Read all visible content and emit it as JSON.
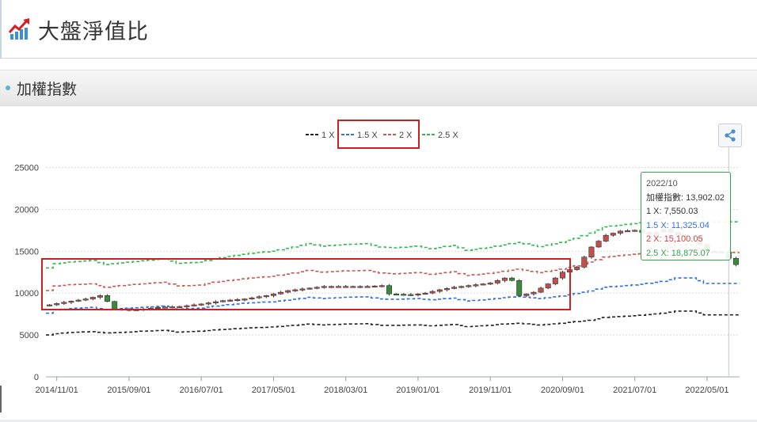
{
  "header": {
    "title": "大盤淨值比",
    "logo_icon": "rising-bar-chart-icon"
  },
  "section": {
    "label": "加權指數"
  },
  "export": {
    "icon": "share-icon"
  },
  "tooltip": {
    "date": "2022/10",
    "main": "加權指數: 13,902.02",
    "s1": "1 X: 7,550.03",
    "s2": "1.5 X: 11,325.04",
    "s3": "2 X: 15,100.05",
    "s4": "2.5 X: 18,875.07"
  },
  "colors": {
    "s1": "#222222",
    "s2": "#2f6fe0",
    "s3": "#c85a52",
    "s4": "#2eb84e",
    "up": "#c0504d",
    "down": "#3a8a3a",
    "highlight": "#d01f1f"
  },
  "chart_data": {
    "type": "line",
    "title": "",
    "xlabel": "",
    "ylabel": "",
    "ylim": [
      0,
      27500
    ],
    "yticks": [
      0,
      5000,
      10000,
      15000,
      20000,
      25000
    ],
    "xtick_labels": [
      "2014/11/01",
      "2015/09/01",
      "2016/07/01",
      "2017/05/01",
      "2018/03/01",
      "2019/01/01",
      "2019/11/01",
      "2020/09/01",
      "2021/07/01",
      "2022/05/01"
    ],
    "xtick_index": [
      1,
      11,
      21,
      31,
      41,
      51,
      61,
      71,
      81,
      91
    ],
    "start_month": "2014/10",
    "legend_position": "top",
    "series": [
      {
        "name": "1 X",
        "key": "s1",
        "knots": [
          [
            0,
            5000
          ],
          [
            1,
            5150
          ],
          [
            3,
            5300
          ],
          [
            6,
            5400
          ],
          [
            8,
            5250
          ],
          [
            10,
            5300
          ],
          [
            13,
            5450
          ],
          [
            16,
            5550
          ],
          [
            18,
            5350
          ],
          [
            21,
            5450
          ],
          [
            23,
            5600
          ],
          [
            26,
            5750
          ],
          [
            28,
            5850
          ],
          [
            31,
            5950
          ],
          [
            34,
            6150
          ],
          [
            36,
            6300
          ],
          [
            38,
            6200
          ],
          [
            41,
            6300
          ],
          [
            44,
            6350
          ],
          [
            46,
            6150
          ],
          [
            48,
            6150
          ],
          [
            51,
            6200
          ],
          [
            53,
            6100
          ],
          [
            56,
            6250
          ],
          [
            58,
            6000
          ],
          [
            61,
            6150
          ],
          [
            63,
            6300
          ],
          [
            65,
            6400
          ],
          [
            68,
            6200
          ],
          [
            71,
            6400
          ],
          [
            73,
            6600
          ],
          [
            75,
            6750
          ],
          [
            77,
            7100
          ],
          [
            80,
            7250
          ],
          [
            82,
            7350
          ],
          [
            85,
            7600
          ],
          [
            87,
            7850
          ],
          [
            89,
            7850
          ],
          [
            91,
            7400
          ],
          [
            95,
            7400
          ]
        ]
      },
      {
        "name": "1.5 X",
        "key": "s2",
        "knots": [
          [
            0,
            7600
          ],
          [
            1,
            8000
          ],
          [
            3,
            8150
          ],
          [
            6,
            8300
          ],
          [
            8,
            8000
          ],
          [
            10,
            8150
          ],
          [
            13,
            8300
          ],
          [
            16,
            8450
          ],
          [
            18,
            8100
          ],
          [
            21,
            8200
          ],
          [
            23,
            8450
          ],
          [
            26,
            8700
          ],
          [
            28,
            8850
          ],
          [
            31,
            8950
          ],
          [
            34,
            9250
          ],
          [
            36,
            9500
          ],
          [
            38,
            9350
          ],
          [
            41,
            9500
          ],
          [
            44,
            9550
          ],
          [
            46,
            9300
          ],
          [
            48,
            9250
          ],
          [
            51,
            9350
          ],
          [
            53,
            9200
          ],
          [
            56,
            9400
          ],
          [
            58,
            9050
          ],
          [
            61,
            9250
          ],
          [
            63,
            9450
          ],
          [
            65,
            9600
          ],
          [
            68,
            9350
          ],
          [
            71,
            9650
          ],
          [
            73,
            9950
          ],
          [
            75,
            10250
          ],
          [
            77,
            10700
          ],
          [
            80,
            10900
          ],
          [
            82,
            11050
          ],
          [
            85,
            11400
          ],
          [
            87,
            11800
          ],
          [
            89,
            11800
          ],
          [
            91,
            11150
          ],
          [
            95,
            11150
          ]
        ]
      },
      {
        "name": "2 X",
        "key": "s3",
        "knots": [
          [
            0,
            10300
          ],
          [
            1,
            10850
          ],
          [
            3,
            11000
          ],
          [
            6,
            11100
          ],
          [
            8,
            10700
          ],
          [
            10,
            10900
          ],
          [
            13,
            11100
          ],
          [
            16,
            11300
          ],
          [
            18,
            10850
          ],
          [
            21,
            10950
          ],
          [
            23,
            11300
          ],
          [
            26,
            11600
          ],
          [
            28,
            11800
          ],
          [
            31,
            12000
          ],
          [
            34,
            12400
          ],
          [
            36,
            12700
          ],
          [
            38,
            12500
          ],
          [
            41,
            12650
          ],
          [
            44,
            12700
          ],
          [
            46,
            12400
          ],
          [
            48,
            12300
          ],
          [
            51,
            12450
          ],
          [
            53,
            12250
          ],
          [
            56,
            12550
          ],
          [
            58,
            12100
          ],
          [
            61,
            12350
          ],
          [
            63,
            12600
          ],
          [
            65,
            12850
          ],
          [
            68,
            12450
          ],
          [
            71,
            12850
          ],
          [
            73,
            13250
          ],
          [
            75,
            13700
          ],
          [
            77,
            14300
          ],
          [
            80,
            14550
          ],
          [
            82,
            14700
          ],
          [
            85,
            15200
          ],
          [
            87,
            15750
          ],
          [
            89,
            15750
          ],
          [
            91,
            14850
          ],
          [
            95,
            14850
          ]
        ]
      },
      {
        "name": "2.5 X",
        "key": "s4",
        "knots": [
          [
            0,
            13000
          ],
          [
            1,
            13500
          ],
          [
            3,
            13700
          ],
          [
            6,
            13900
          ],
          [
            8,
            13400
          ],
          [
            10,
            13600
          ],
          [
            13,
            13850
          ],
          [
            16,
            14100
          ],
          [
            18,
            13550
          ],
          [
            21,
            13700
          ],
          [
            23,
            14100
          ],
          [
            26,
            14500
          ],
          [
            28,
            14750
          ],
          [
            31,
            15000
          ],
          [
            34,
            15500
          ],
          [
            36,
            15900
          ],
          [
            38,
            15600
          ],
          [
            41,
            15800
          ],
          [
            44,
            15900
          ],
          [
            46,
            15500
          ],
          [
            48,
            15400
          ],
          [
            51,
            15600
          ],
          [
            53,
            15300
          ],
          [
            56,
            15700
          ],
          [
            58,
            15100
          ],
          [
            61,
            15450
          ],
          [
            63,
            15750
          ],
          [
            65,
            16050
          ],
          [
            68,
            15550
          ],
          [
            71,
            16050
          ],
          [
            73,
            16550
          ],
          [
            75,
            17150
          ],
          [
            77,
            17900
          ],
          [
            80,
            18200
          ],
          [
            82,
            18400
          ],
          [
            85,
            19000
          ],
          [
            87,
            19700
          ],
          [
            89,
            19700
          ],
          [
            91,
            18500
          ],
          [
            95,
            18500
          ]
        ]
      },
      {
        "name": "加權指數",
        "key": "index",
        "type": "candlestick",
        "close_knots": [
          [
            0,
            8600
          ],
          [
            2,
            8900
          ],
          [
            5,
            9300
          ],
          [
            7,
            9700
          ],
          [
            8,
            9000
          ],
          [
            9,
            8100
          ],
          [
            12,
            8000
          ],
          [
            15,
            8300
          ],
          [
            18,
            8400
          ],
          [
            21,
            8700
          ],
          [
            24,
            9100
          ],
          [
            27,
            9300
          ],
          [
            30,
            9700
          ],
          [
            33,
            10300
          ],
          [
            36,
            10600
          ],
          [
            38,
            10800
          ],
          [
            41,
            10800
          ],
          [
            44,
            10800
          ],
          [
            46,
            10900
          ],
          [
            47,
            9900
          ],
          [
            50,
            9800
          ],
          [
            52,
            10000
          ],
          [
            54,
            10400
          ],
          [
            56,
            10700
          ],
          [
            58,
            10900
          ],
          [
            61,
            11200
          ],
          [
            63,
            11800
          ],
          [
            64,
            11500
          ],
          [
            65,
            9700
          ],
          [
            67,
            10100
          ],
          [
            69,
            11100
          ],
          [
            71,
            12500
          ],
          [
            73,
            13100
          ],
          [
            75,
            15500
          ],
          [
            77,
            16900
          ],
          [
            79,
            17400
          ],
          [
            81,
            17500
          ],
          [
            83,
            17000
          ],
          [
            85,
            17600
          ],
          [
            87,
            16900
          ],
          [
            89,
            16600
          ],
          [
            91,
            15000
          ],
          [
            93,
            14900
          ],
          [
            95,
            13400
          ]
        ]
      }
    ]
  }
}
